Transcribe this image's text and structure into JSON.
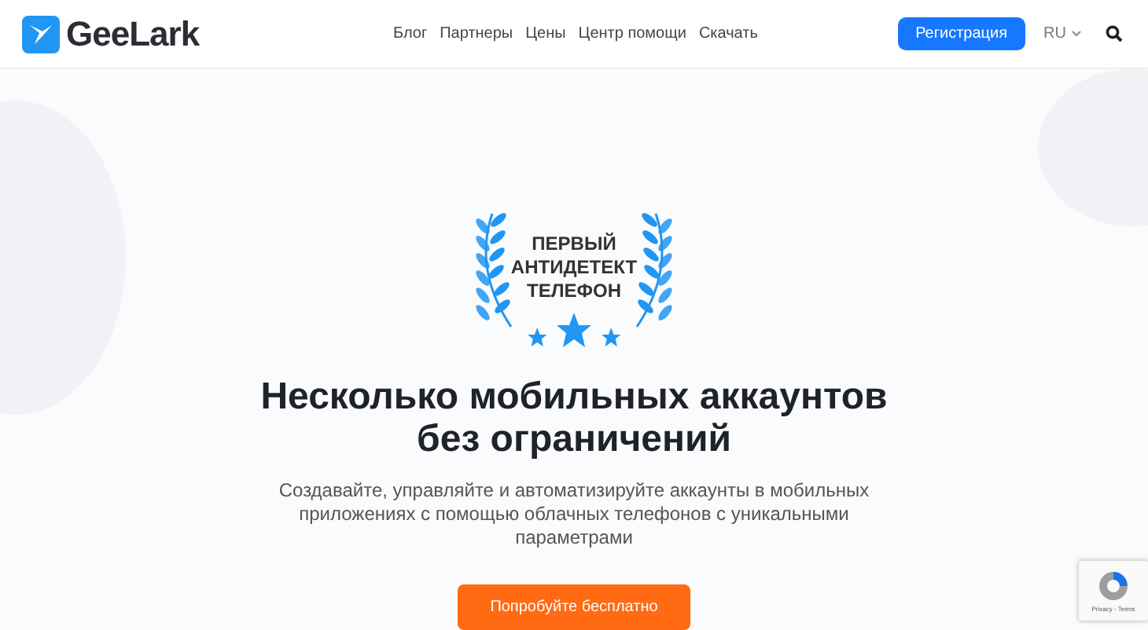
{
  "header": {
    "logo": "GeeLark",
    "nav": [
      "Блог",
      "Партнеры",
      "Цены",
      "Центр помощи",
      "Скачать"
    ],
    "register_button": "Регистрация",
    "language": "RU"
  },
  "hero": {
    "badge_lines": [
      "ПЕРВЫЙ",
      "АНТИДЕТЕКТ",
      "ТЕЛЕФОН"
    ],
    "title_lines": [
      "Несколько мобильных аккаунтов",
      "без ограничений"
    ],
    "subtitle": "Создавайте, управляйте и автоматизируйте аккаунты в мобильных приложениях с помощью облачных телефонов с уникальными параметрами",
    "cta": "Попробуйте бесплатно"
  },
  "recaptcha": {
    "links": "Privacy - Terms"
  }
}
